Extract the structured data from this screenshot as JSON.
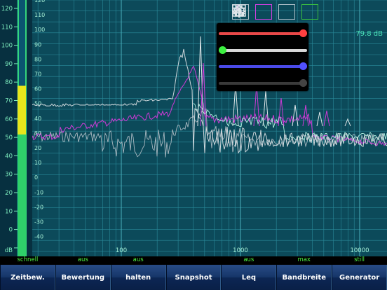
{
  "meter": {
    "scale": [
      "120",
      "110",
      "100",
      "90",
      "80",
      "70",
      "60",
      "50",
      "40",
      "30",
      "20",
      "10",
      "0",
      "dB"
    ],
    "level_db": 78
  },
  "plot": {
    "y_ticks": [
      "120",
      "110",
      "100",
      "90",
      "80",
      "70",
      "60",
      "50",
      "40",
      "30",
      "20",
      "10",
      "0",
      "-10",
      "-20",
      "-30",
      "-40"
    ],
    "x_labels": [
      "100",
      "1000",
      "10000"
    ],
    "level_readout": "79.8 dB"
  },
  "toolbar": {
    "icons": [
      "spectrum-scope-icon",
      "spectrum-peak-icon",
      "spectrum-smooth-icon",
      "waveform-green-icon",
      "grid-icon",
      "bar-chart-icon",
      "gear-icon"
    ]
  },
  "popup": {
    "sliders": [
      {
        "name": "red",
        "color": "#e84848",
        "value": 1.0
      },
      {
        "name": "green",
        "color": "#ececec",
        "value": 0.0
      },
      {
        "name": "blue",
        "color": "#4a4ae8",
        "value": 1.0
      },
      {
        "name": "gray",
        "color": "#333333",
        "value": 1.0
      }
    ]
  },
  "status": [
    {
      "text": "schnell"
    },
    {
      "text": "aus"
    },
    {
      "text": "aus"
    },
    {
      "text": ""
    },
    {
      "text": "aus"
    },
    {
      "text": "max"
    },
    {
      "text": "still"
    }
  ],
  "buttons": [
    {
      "label": "Zeitbew."
    },
    {
      "label": "Bewertung"
    },
    {
      "label": "halten"
    },
    {
      "label": "Snapshot"
    },
    {
      "label": "Leq"
    },
    {
      "label": "Bandbreite"
    },
    {
      "label": "Generator"
    }
  ]
}
